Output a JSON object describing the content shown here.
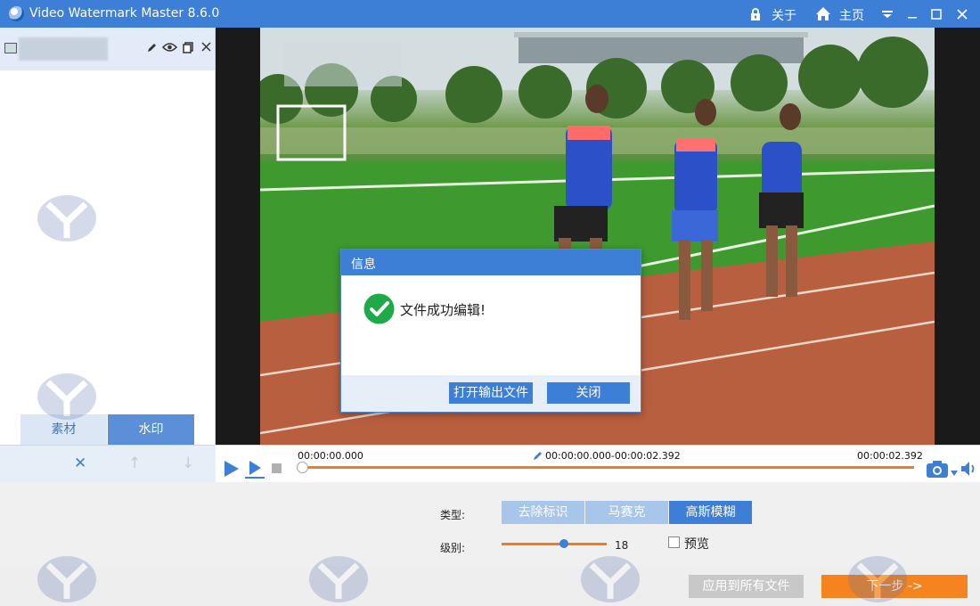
{
  "window": {
    "title": "Video Watermark Master 8.6.0",
    "about_label": "关于",
    "home_label": "主页"
  },
  "left_panel": {
    "tabs": [
      {
        "label": "素材",
        "active": false
      },
      {
        "label": "水印",
        "active": true
      }
    ],
    "controls": {
      "remove": "✕",
      "up": "↑",
      "down": "↓"
    }
  },
  "transport": {
    "start_time": "00:00:00.000",
    "range": "00:00:00.000-00:00:02.392",
    "end_time": "00:00:02.392",
    "progress": 0
  },
  "settings": {
    "type_label": "类型:",
    "type_options": [
      {
        "label": "去除标识",
        "active": false
      },
      {
        "label": "马赛克",
        "active": false
      },
      {
        "label": "高斯模糊",
        "active": true
      }
    ],
    "level_label": "级别:",
    "level_value": "18",
    "preview_label": "预览",
    "preview_checked": false
  },
  "footer": {
    "apply_all_label": "应用到所有文件",
    "next_label": "下一步 ->"
  },
  "dialog": {
    "title": "信息",
    "message": "文件成功编辑!",
    "open_output_label": "打开输出文件",
    "close_label": "关闭"
  },
  "colors": {
    "accent": "#3d7ed6",
    "orange": "#f07c1f",
    "success": "#1faa4a"
  }
}
